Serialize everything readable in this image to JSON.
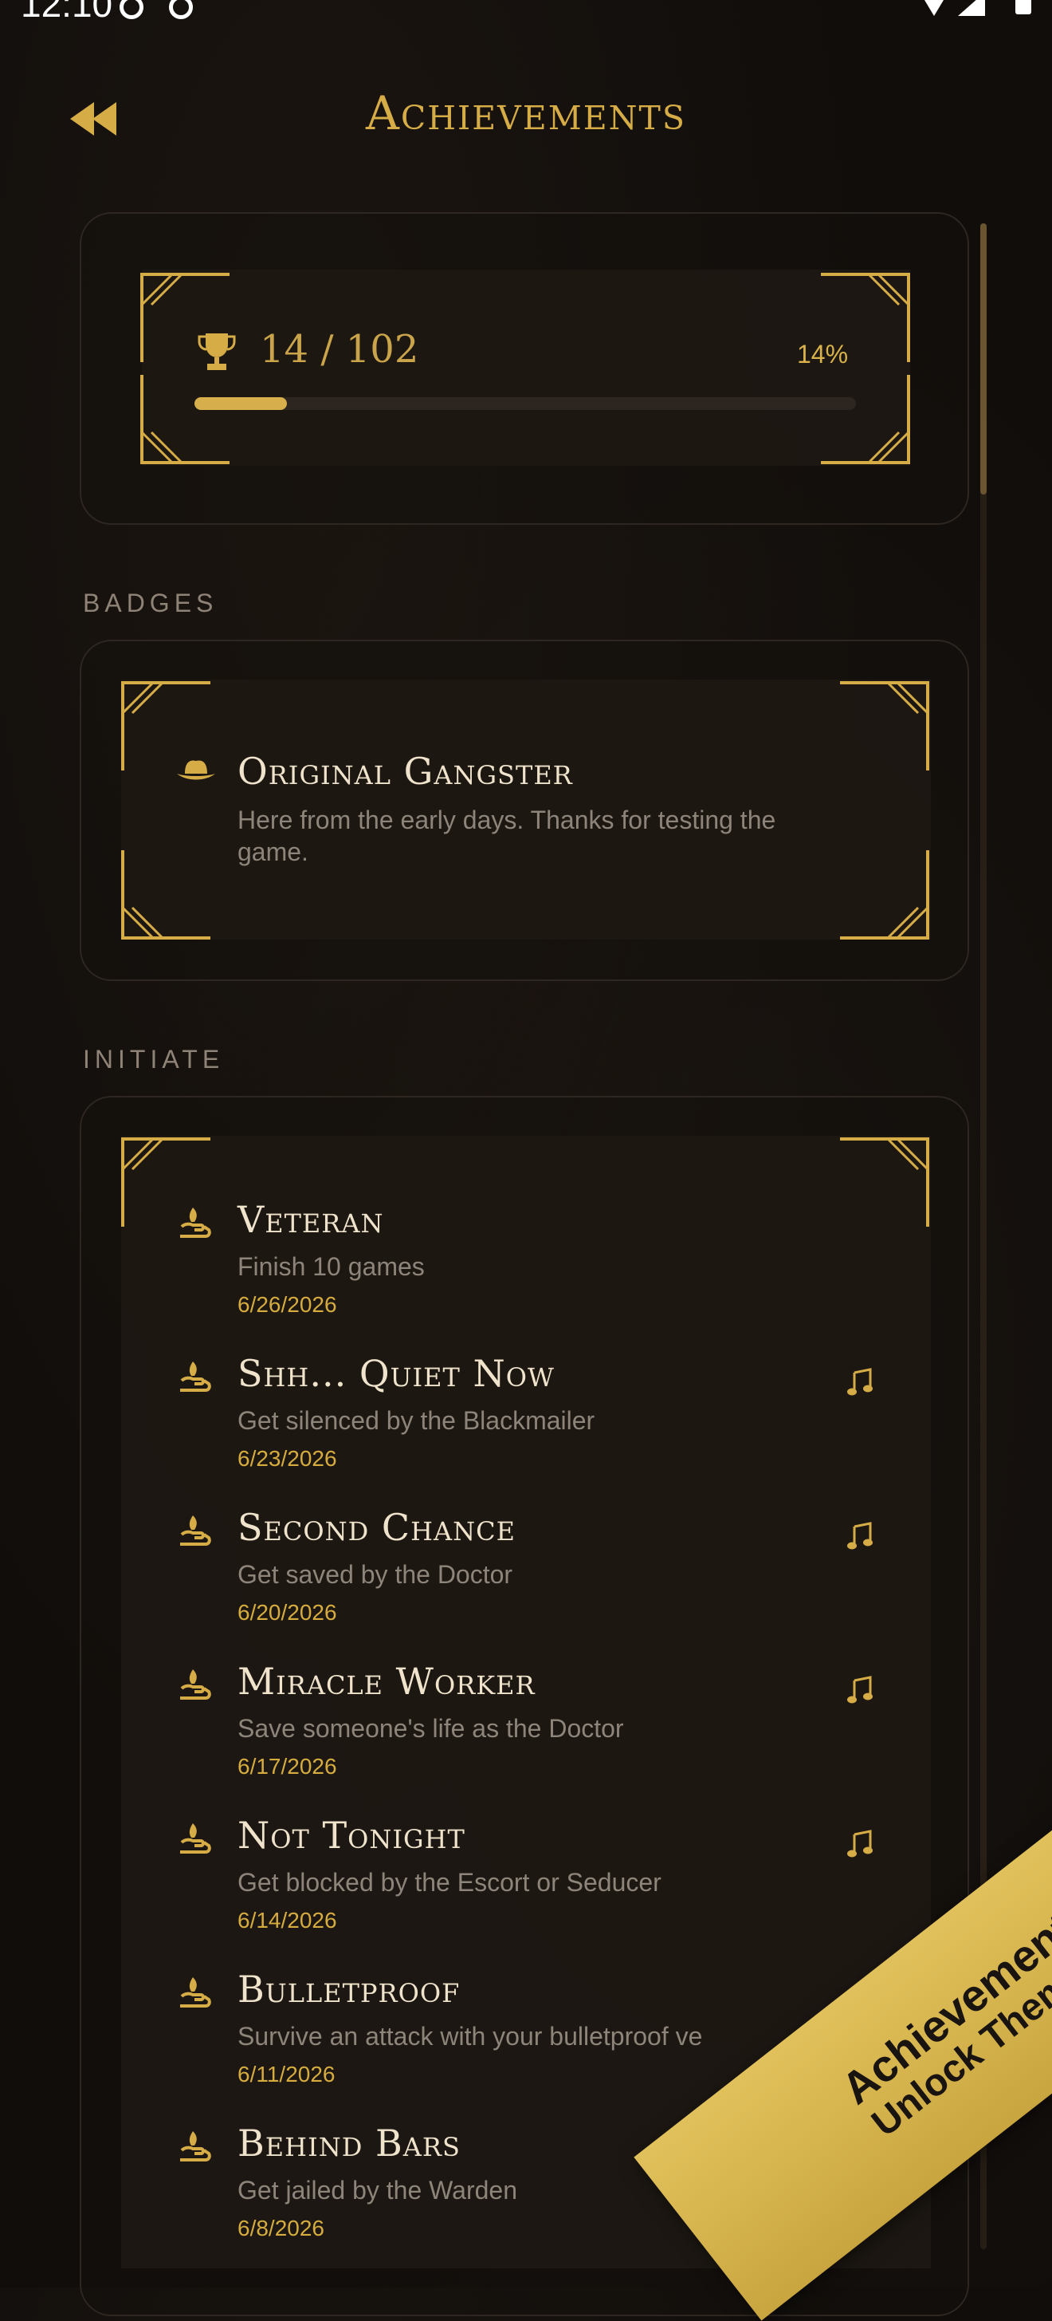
{
  "status_bar": {
    "time": "12:10"
  },
  "header": {
    "title": "Achievements",
    "back_icon": "double-chevron-left-icon"
  },
  "summary": {
    "icon": "trophy-icon",
    "count": "14 / 102",
    "percent": "14%",
    "progress": 0.14
  },
  "badges": {
    "section_label": "BADGES",
    "items": [
      {
        "icon": "fedora-hat-icon",
        "title": "Original Gangster",
        "desc_line1": "Here from the early days. Thanks for testing the",
        "desc_line2": "game."
      }
    ]
  },
  "initiate": {
    "section_label": "INITIATE",
    "items": [
      {
        "icon": "hand-icon",
        "title": "Veteran",
        "desc": "Finish 10 games",
        "date": "6/26/2026",
        "sound": false
      },
      {
        "icon": "hand-icon",
        "title": "Shh... Quiet Now",
        "desc": "Get silenced by the Blackmailer",
        "date": "6/23/2026",
        "sound": true
      },
      {
        "icon": "hand-icon",
        "title": "Second Chance",
        "desc": "Get saved by the Doctor",
        "date": "6/20/2026",
        "sound": true
      },
      {
        "icon": "hand-icon",
        "title": "Miracle Worker",
        "desc": "Save someone's life as the Doctor",
        "date": "6/17/2026",
        "sound": true
      },
      {
        "icon": "hand-icon",
        "title": "Not Tonight",
        "desc": "Get blocked by the Escort or Seducer",
        "date": "6/14/2026",
        "sound": true
      },
      {
        "icon": "hand-icon",
        "title": "Bulletproof",
        "desc": "Survive an attack with your bulletproof ve",
        "date": "6/11/2026",
        "sound": false
      },
      {
        "icon": "hand-icon",
        "title": "Behind Bars",
        "desc": "Get jailed by the Warden",
        "date": "6/8/2026",
        "sound": true
      }
    ]
  },
  "promo": {
    "line1": "Achievements",
    "line2": "Unlock Them All"
  },
  "colors": {
    "accent": "#d6ac47",
    "background": "#100d0b",
    "title_text": "#efe3cc",
    "muted_text": "#8d847a"
  }
}
